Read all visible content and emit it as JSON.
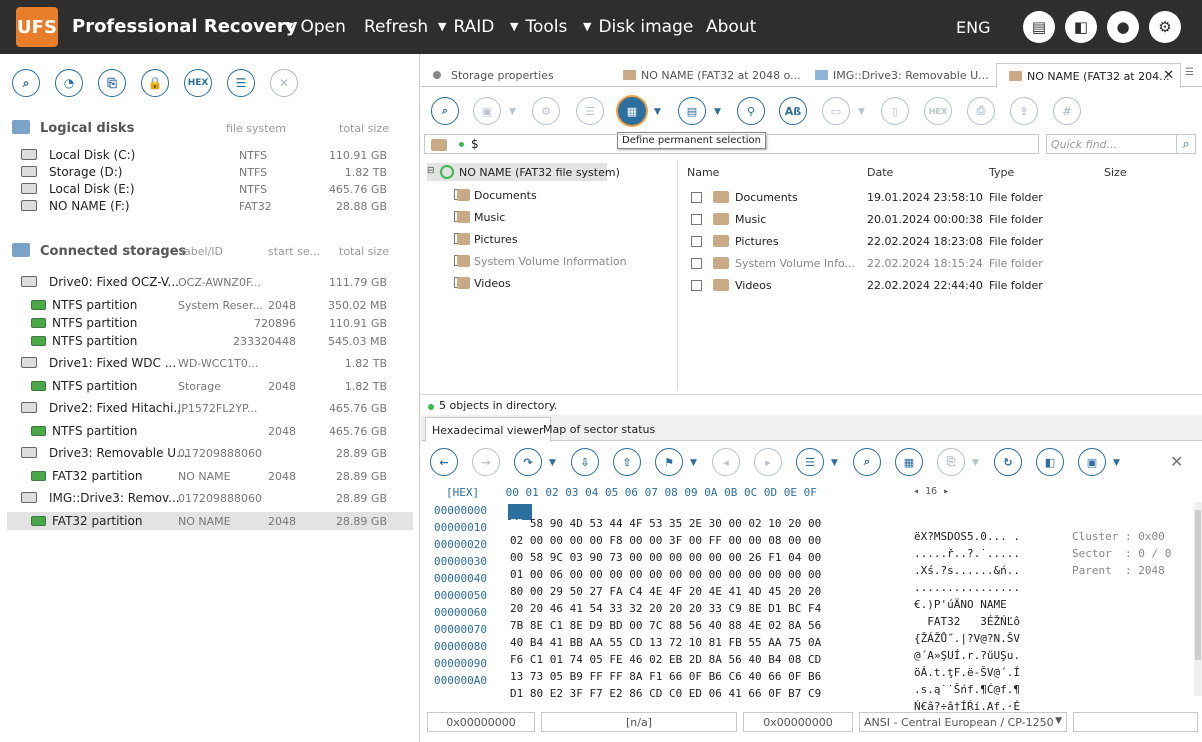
{
  "app": {
    "title": "Professional Recovery",
    "logo": "UFS"
  },
  "menu": [
    {
      "label": "Open",
      "dropdown": true
    },
    {
      "label": "Refresh",
      "dropdown": false
    },
    {
      "label": "RAID",
      "dropdown": true
    },
    {
      "label": "Tools",
      "dropdown": true
    },
    {
      "label": "Disk image",
      "dropdown": true
    },
    {
      "label": "About",
      "dropdown": false
    }
  ],
  "lang": "ENG",
  "top_buttons": [
    "monitor-icon",
    "panels-icon",
    "user-icon",
    "gear-icon"
  ],
  "left_toolbar": [
    "search-icon",
    "scan-icon",
    "copy-icon",
    "lock-icon",
    "HEX",
    "list-icon",
    "close-icon"
  ],
  "logical": {
    "title": "Logical disks",
    "col_fs": "file system",
    "col_size": "total size",
    "disks": [
      {
        "name": "Local Disk (C:)",
        "fs": "NTFS",
        "size": "110.91 GB"
      },
      {
        "name": "Storage (D:)",
        "fs": "NTFS",
        "size": "1.82 TB"
      },
      {
        "name": "Local Disk (E:)",
        "fs": "NTFS",
        "size": "465.76 GB"
      },
      {
        "name": "NO NAME (F:)",
        "fs": "FAT32",
        "size": "28.88 GB"
      }
    ]
  },
  "storages": {
    "title": "Connected storages",
    "col_label": "label/ID",
    "col_start": "start se...",
    "col_size": "total size",
    "items": [
      {
        "name": "Drive0: Fixed OCZ-V...",
        "label": "OCZ-AWNZ0F...",
        "start": "",
        "size": "111.79 GB",
        "type": "drive"
      },
      {
        "name": "NTFS partition",
        "label": "System Reser...",
        "start": "2048",
        "size": "350.02 MB",
        "type": "part"
      },
      {
        "name": "NTFS partition",
        "label": "",
        "start": "720896",
        "size": "110.91 GB",
        "type": "part"
      },
      {
        "name": "NTFS partition",
        "label": "",
        "start": "233320448",
        "size": "545.03 MB",
        "type": "part"
      },
      {
        "name": "Drive1: Fixed WDC ...",
        "label": "WD-WCC1T0...",
        "start": "",
        "size": "1.82 TB",
        "type": "drive"
      },
      {
        "name": "NTFS partition",
        "label": "Storage",
        "start": "2048",
        "size": "1.82 TB",
        "type": "part"
      },
      {
        "name": "Drive2: Fixed Hitachi...",
        "label": "JP1572FL2YP...",
        "start": "",
        "size": "465.76 GB",
        "type": "drive"
      },
      {
        "name": "NTFS partition",
        "label": "",
        "start": "2048",
        "size": "465.76 GB",
        "type": "part"
      },
      {
        "name": "Drive3: Removable U...",
        "label": "017209888060",
        "start": "",
        "size": "28.89 GB",
        "type": "drive"
      },
      {
        "name": "FAT32 partition",
        "label": "NO NAME",
        "start": "2048",
        "size": "28.89 GB",
        "type": "part"
      },
      {
        "name": "IMG::Drive3: Remov...",
        "label": "017209888060",
        "start": "",
        "size": "28.89 GB",
        "type": "drive"
      },
      {
        "name": "FAT32 partition",
        "label": "NO NAME",
        "start": "2048",
        "size": "28.89 GB",
        "type": "part",
        "selected": true
      }
    ]
  },
  "tabs": [
    {
      "label": "Storage properties"
    },
    {
      "label": "NO NAME (FAT32 at 2048 o..."
    },
    {
      "label": "IMG::Drive3: Removable U..."
    },
    {
      "label": "NO NAME (FAT32 at 204...",
      "active": true
    }
  ],
  "tooltip": "Define permanent selection",
  "path": "$",
  "find_placeholder": "Quick find...",
  "tree": {
    "root": "NO NAME (FAT32 file system)",
    "children": [
      "Documents",
      "Music",
      "Pictures",
      "System Volume Information",
      "Videos"
    ]
  },
  "files": {
    "headers": {
      "name": "Name",
      "date": "Date",
      "type": "Type",
      "size": "Size"
    },
    "rows": [
      {
        "name": "Documents",
        "date": "19.01.2024 23:58:10",
        "type": "File folder",
        "dim": false
      },
      {
        "name": "Music",
        "date": "20.01.2024 00:00:38",
        "type": "File folder",
        "dim": false
      },
      {
        "name": "Pictures",
        "date": "22.02.2024 18:23:08",
        "type": "File folder",
        "dim": false
      },
      {
        "name": "System Volume Info...",
        "date": "22.02.2024 18:15:24",
        "type": "File folder",
        "dim": true
      },
      {
        "name": "Videos",
        "date": "22.02.2024 22:44:40",
        "type": "File folder",
        "dim": false
      }
    ]
  },
  "status": "5 objects in directory.",
  "viewer_tabs": [
    "Hexadecimal viewer",
    "Map of sector status"
  ],
  "hex": {
    "header": "[HEX]    00 01 02 03 04 05 06 07 08 09 0A 0B 0C 0D 0E 0F",
    "page": "16",
    "rows": [
      {
        "addr": "00000000",
        "bytes": "EB 58 90 4D 53 44 4F 53 35 2E 30 00 02 10 20 00",
        "text": "ëX?MSDOS5.0... ."
      },
      {
        "addr": "00000010",
        "bytes": "02 00 00 00 00 F8 00 00 3F 00 FF 00 00 08 00 00",
        "text": ".....ř..?.˙....."
      },
      {
        "addr": "00000020",
        "bytes": "00 58 9C 03 90 73 00 00 00 00 00 00 26 F1 04 00",
        "text": ".Xś.?s......&ń.."
      },
      {
        "addr": "00000030",
        "bytes": "01 00 06 00 00 00 00 00 00 00 00 00 00 00 00 00",
        "text": "................"
      },
      {
        "addr": "00000040",
        "bytes": "80 00 29 50 27 FA C4 4E 4F 20 4E 41 4D 45 20 20",
        "text": "€.)P'úÄNO NAME  "
      },
      {
        "addr": "00000050",
        "bytes": "20 20 46 41 54 33 32 20 20 20 33 C9 8E D1 BC F4",
        "text": "  FAT32   3ÉŽŃĽô"
      },
      {
        "addr": "00000060",
        "bytes": "7B 8E C1 8E D9 BD 00 7C 88 56 40 88 4E 02 8A 56",
        "text": "{ŽÁŽŮ˝.|?V@?N.ŠV"
      },
      {
        "addr": "00000070",
        "bytes": "40 B4 41 BB AA 55 CD 13 72 10 81 FB 55 AA 75 0A",
        "text": "@´A»ŞUÍ.r.?űUŞu."
      },
      {
        "addr": "00000080",
        "bytes": "F6 C1 01 74 05 FE 46 02 EB 2D 8A 56 40 B4 08 CD",
        "text": "öÁ.t.ţF.ë-ŠV@´.Í"
      },
      {
        "addr": "00000090",
        "bytes": "13 73 05 B9 FF FF 8A F1 66 0F B6 C6 40 66 0F B6",
        "text": ".s.ą˙˙Šńf.¶Ć@f.¶"
      },
      {
        "addr": "000000A0",
        "bytes": "D1 80 E2 3F F7 E2 86 CD C0 ED 06 41 66 0F B7 C9",
        "text": "Ń€â?÷â†ÍŔí.Af.·É"
      }
    ],
    "info": [
      "Cluster : 0x00",
      "Sector  : 0 / 0",
      "Parent  : 2048"
    ]
  },
  "footer": {
    "offset": "0x00000000",
    "na": "[n/a]",
    "offset2": "0x00000000",
    "encoding": "ANSI - Central European / CP-1250"
  }
}
